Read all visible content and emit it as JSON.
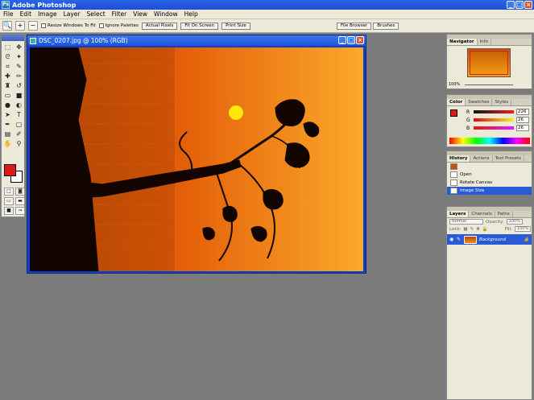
{
  "app": {
    "title": "Adobe Photoshop",
    "icon": "Ps"
  },
  "window_controls": {
    "minimize": "_",
    "maximize": "□",
    "close": "×"
  },
  "menu": [
    "File",
    "Edit",
    "Image",
    "Layer",
    "Select",
    "Filter",
    "View",
    "Window",
    "Help"
  ],
  "options_bar": {
    "resize_windows": "Resize Windows To Fit",
    "ignore_palettes": "Ignore Palettes",
    "actual_pixels": "Actual Pixels",
    "fit_on_screen": "Fit On Screen",
    "print_size": "Print Size",
    "well_tabs": [
      "File Browser",
      "Brushes"
    ]
  },
  "document": {
    "title": "DSC_0207.jpg @ 100% (RGB)"
  },
  "navigator": {
    "tabs": [
      "Navigator",
      "Info"
    ],
    "zoom": "100%"
  },
  "color": {
    "tabs": [
      "Color",
      "Swatches",
      "Styles"
    ],
    "r": {
      "label": "R",
      "value": "226"
    },
    "g": {
      "label": "G",
      "value": "26"
    },
    "b": {
      "label": "B",
      "value": "26"
    },
    "foreground": "#e21a1a"
  },
  "history": {
    "tabs": [
      "History",
      "Actions",
      "Tool Presets"
    ],
    "items": [
      "Open",
      "Rotate Canvas",
      "Image Size"
    ]
  },
  "layers": {
    "tabs": [
      "Layers",
      "Channels",
      "Paths"
    ],
    "blend_mode": "Normal",
    "opacity_label": "Opacity:",
    "opacity": "100%",
    "lock_label": "Lock:",
    "fill_label": "Fill:",
    "fill": "100%",
    "layer_name": "Background"
  }
}
